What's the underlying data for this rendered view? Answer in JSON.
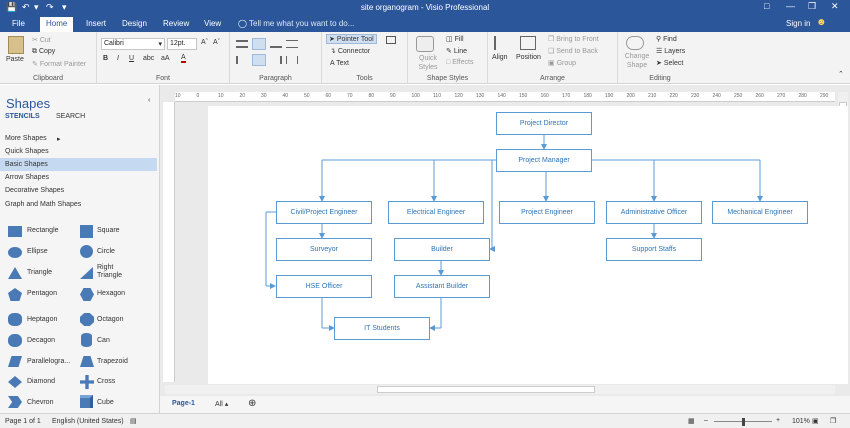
{
  "titlebar": {
    "title": "site organogram - Visio Professional"
  },
  "tabs": [
    "File",
    "Home",
    "Insert",
    "Design",
    "Review",
    "View"
  ],
  "tell_me": "Tell me what you want to do...",
  "account": {
    "sign_in": "Sign in"
  },
  "ribbon": {
    "clipboard": {
      "paste": "Paste",
      "cut": "Cut",
      "copy": "Copy",
      "format_painter": "Format Painter",
      "label": "Clipboard"
    },
    "font": {
      "family": "Calibri",
      "size": "12pt.",
      "label": "Font"
    },
    "paragraph": {
      "label": "Paragraph"
    },
    "tools": {
      "pointer": "Pointer Tool",
      "connector": "Connector",
      "text": "Text",
      "label": "Tools"
    },
    "shape_styles": {
      "quick_styles": "Quick Styles",
      "fill": "Fill",
      "line": "Line",
      "effects": "Effects",
      "label": "Shape Styles"
    },
    "arrange": {
      "align": "Align",
      "position": "Position",
      "bring_front": "Bring to Front",
      "send_back": "Send to Back",
      "group": "Group",
      "label": "Arrange"
    },
    "editing": {
      "change_shape": "Change Shape",
      "find": "Find",
      "layers": "Layers",
      "select": "Select",
      "label": "Editing"
    }
  },
  "shapes_pane": {
    "title": "Shapes",
    "tabs": [
      "STENCILS",
      "SEARCH"
    ],
    "menu": [
      "More Shapes",
      "Quick Shapes",
      "Basic Shapes",
      "Arrow Shapes",
      "Decorative Shapes",
      "Graph and Math Shapes"
    ],
    "shapes": [
      "Rectangle",
      "Square",
      "Ellipse",
      "Circle",
      "Triangle",
      "Right Triangle",
      "Pentagon",
      "Hexagon",
      "Heptagon",
      "Octagon",
      "Decagon",
      "Can",
      "Parallelogra...",
      "Trapezoid",
      "Diamond",
      "Cross",
      "Chevron",
      "Cube"
    ]
  },
  "ruler": {
    "ticks": [
      "10",
      "0",
      "10",
      "20",
      "30",
      "40",
      "50",
      "60",
      "70",
      "80",
      "90",
      "100",
      "110",
      "120",
      "130",
      "140",
      "150",
      "160",
      "170",
      "180",
      "190",
      "200",
      "210",
      "220",
      "230",
      "240",
      "250",
      "260",
      "270",
      "280",
      "290"
    ]
  },
  "diagram": {
    "nodes": {
      "director": "Project Director",
      "manager": "Project Manager",
      "civil": "Civil/Project Engineer",
      "electrical": "Electrical Engineer",
      "project_eng": "Project Engineer",
      "admin": "Administrative Officer",
      "mechanical": "Mechanical Engineer",
      "surveyor": "Surveyor",
      "builder": "Builder",
      "support": "Support Staffs",
      "hse": "HSE Officer",
      "asst_builder": "Assistant Builder",
      "it": "IT Students"
    }
  },
  "page_tabs": {
    "current": "Page-1",
    "all": "All"
  },
  "status": {
    "page": "Page 1 of 1",
    "language": "English (United States)",
    "zoom": "101%"
  }
}
